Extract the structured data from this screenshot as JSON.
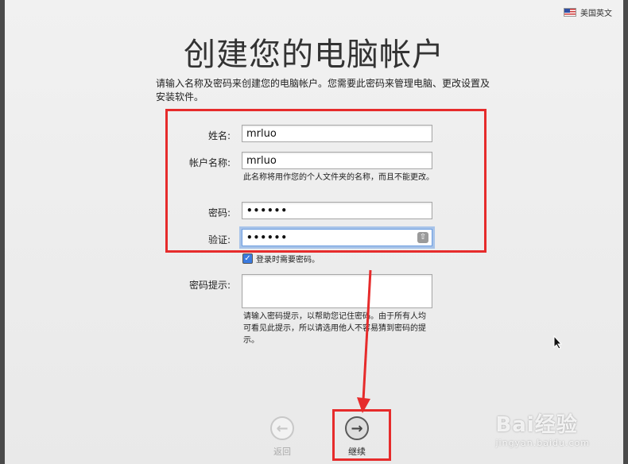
{
  "language": {
    "label": "美国英文",
    "icon": "us-flag-icon"
  },
  "title": "创建您的电脑帐户",
  "intro": "请输入名称及密码来创建您的电脑帐户。您需要此密码来管理电脑、更改设置及安装软件。",
  "form": {
    "fullname_label": "姓名:",
    "fullname_value": "mrluo",
    "account_label": "帐户名称:",
    "account_value": "mrluo",
    "account_note": "此名称将用作您的个人文件夹的名称，而且不能更改。",
    "password_label": "密码:",
    "password_mask": "••••••",
    "verify_label": "验证:",
    "verify_mask": "••••••",
    "require_password_label": "登录时需要密码。",
    "require_password_checked": true,
    "hint_label": "密码提示:",
    "hint_value": "",
    "hint_note": "请输入密码提示，以帮助您记住密码。由于所有人均可看见此提示，所以请选用他人不容易猜到密码的提示。"
  },
  "nav": {
    "back_label": "返回",
    "next_label": "继续"
  },
  "watermark": {
    "brand": "Bai经验",
    "url": "jingyan.baidu.com"
  },
  "colors": {
    "annotation": "#e62b2b",
    "focus": "#6d9ee0"
  }
}
